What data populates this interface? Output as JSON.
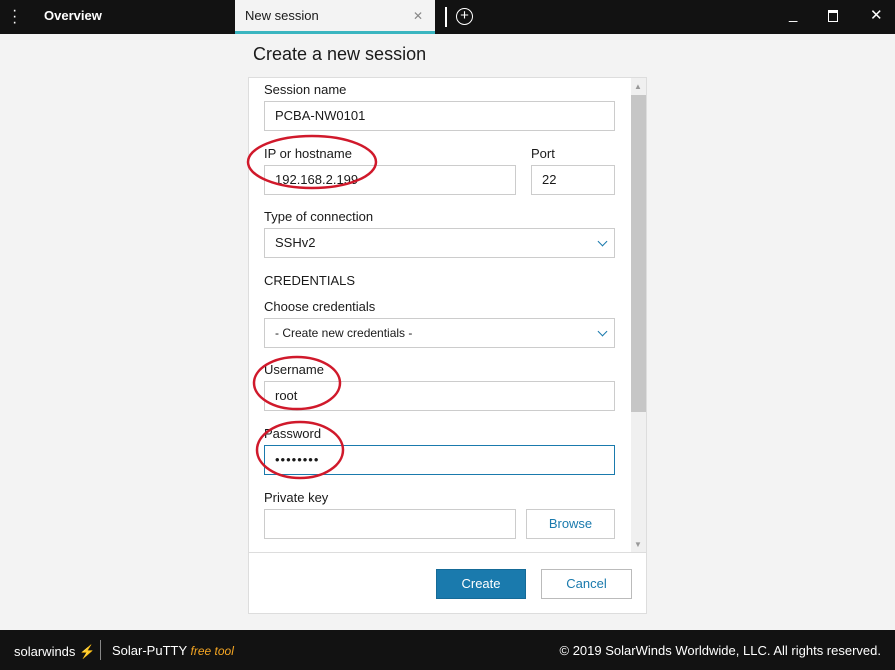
{
  "tabs": [
    {
      "label": "Overview"
    },
    {
      "label": "New session"
    }
  ],
  "title": "Create a new session",
  "form": {
    "session_name": {
      "label": "Session name",
      "value": "PCBA-NW0101"
    },
    "host": {
      "label": "IP or hostname",
      "value": "192.168.2.199"
    },
    "port": {
      "label": "Port",
      "value": "22"
    },
    "connection": {
      "label": "Type of connection",
      "value": "SSHv2"
    },
    "credentials_heading": "CREDENTIALS",
    "choose_credentials": {
      "label": "Choose credentials",
      "value": "- Create new credentials -"
    },
    "username": {
      "label": "Username",
      "value": "root"
    },
    "password": {
      "label": "Password",
      "value": "••••••••"
    },
    "private_key": {
      "label": "Private key",
      "value": "",
      "browse": "Browse"
    }
  },
  "buttons": {
    "create": "Create",
    "cancel": "Cancel"
  },
  "footer": {
    "brand": "solarwinds",
    "product": "Solar-PuTTY",
    "tag": "free tool",
    "copyright": "© 2019 SolarWinds Worldwide, LLC. All rights reserved."
  },
  "colors": {
    "accent": "#1a7aad",
    "tab_underline": "#3ab5c0",
    "annotation": "#d0192b"
  }
}
